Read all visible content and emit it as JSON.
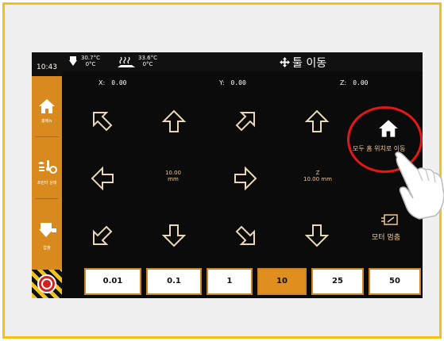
{
  "header": {
    "time": "10:43",
    "nozzle_temp": "30.7°C",
    "nozzle_target": "0°C",
    "bed_temp": "33.6°C",
    "bed_target": "0°C",
    "title": "툴 이동"
  },
  "coords": {
    "x_label": "X:",
    "x": "0.00",
    "y_label": "Y:",
    "y": "0.00",
    "z_label": "Z:",
    "z": "0.00"
  },
  "sidebar": {
    "items": [
      {
        "label": "홈메뉴",
        "icon": "home-icon"
      },
      {
        "label": "프린터 상태",
        "icon": "printer-status-icon"
      },
      {
        "label": "압출",
        "icon": "extrude-icon"
      }
    ]
  },
  "jog": {
    "xy_step": "10.00",
    "xy_unit": "mm",
    "z_label": "Z",
    "z_step": "10.00 mm"
  },
  "actions": {
    "home_all": "모두 홈 위치로 이동",
    "motor_off": "모터 멈춤"
  },
  "steps": [
    "0.01",
    "0.1",
    "1",
    "10",
    "25",
    "50"
  ],
  "active_step": "10",
  "colors": {
    "accent": "#d88a1e",
    "frame": "#f2c21a",
    "highlight": "#e21818"
  }
}
